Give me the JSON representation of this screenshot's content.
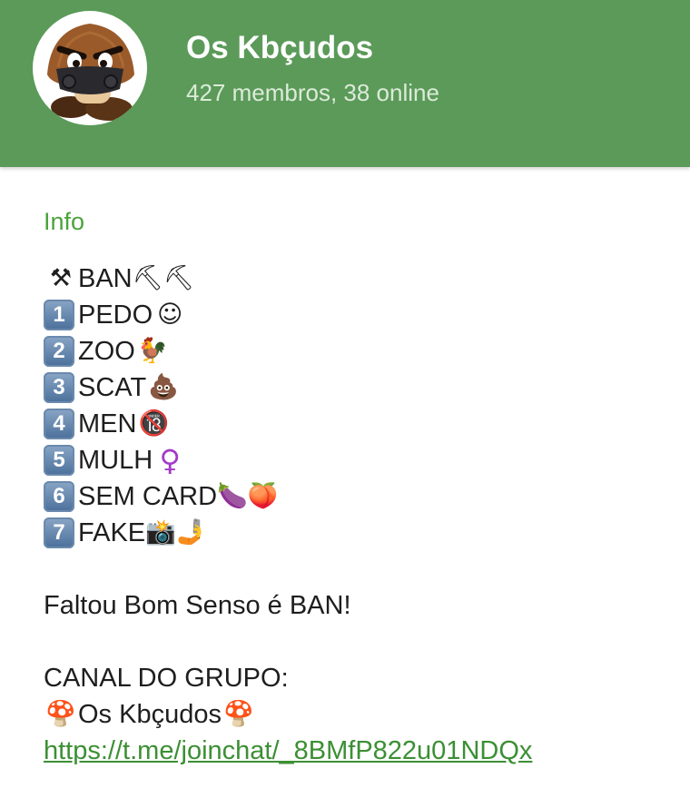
{
  "header": {
    "title": "Os Kbçudos",
    "subtitle": "427 membros, 38 online",
    "avatar_icon": "goomba-mascot-icon",
    "background_color": "#5b9a59"
  },
  "info": {
    "label": "Info",
    "rules_heading": {
      "icon_left": "⚒",
      "text": "BAN",
      "icon_right": "⛏⛏"
    },
    "rules": [
      {
        "number": "1",
        "text": "PEDO",
        "emoji": "☺"
      },
      {
        "number": "2",
        "text": "ZOO",
        "emoji": "🐓"
      },
      {
        "number": "3",
        "text": "SCAT",
        "emoji": "💩"
      },
      {
        "number": "4",
        "text": "MEN",
        "emoji": "🔞"
      },
      {
        "number": "5",
        "text": "MULH",
        "emoji": "♀"
      },
      {
        "number": "6",
        "text": "SEM CARD",
        "emoji": "🍆🍑"
      },
      {
        "number": "7",
        "text": "FAKE",
        "emoji": "📸🤳"
      }
    ],
    "warning": "Faltou Bom Senso é BAN!",
    "channel_heading": "CANAL DO GRUPO:",
    "channel_name": {
      "icon_left": "🍄",
      "text": "Os Kbçudos",
      "icon_right": "🍄"
    },
    "channel_link": "https://t.me/joinchat/_8BMfP822u01NDQx",
    "link_color": "#3c8f34",
    "accent_color": "#4ba33c"
  }
}
